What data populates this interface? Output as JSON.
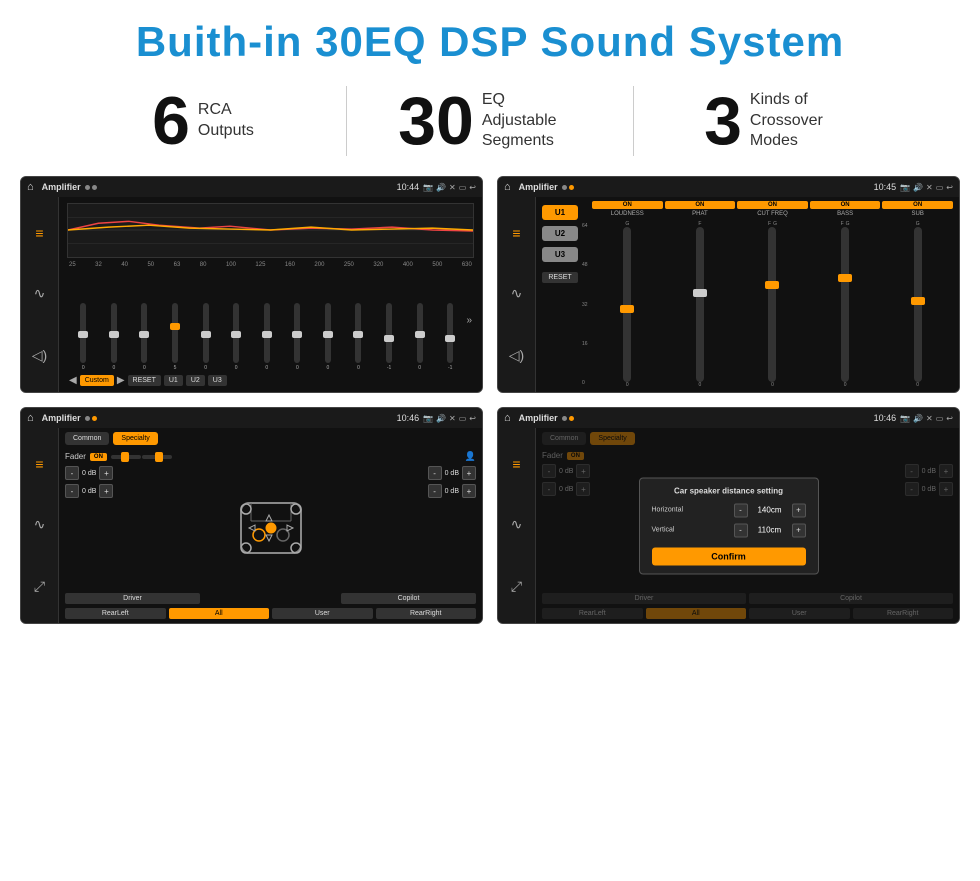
{
  "page": {
    "title": "Buith-in 30EQ DSP Sound System"
  },
  "stats": [
    {
      "number": "6",
      "label_line1": "RCA",
      "label_line2": "Outputs"
    },
    {
      "number": "30",
      "label_line1": "EQ Adjustable",
      "label_line2": "Segments"
    },
    {
      "number": "3",
      "label_line1": "Kinds of",
      "label_line2": "Crossover Modes"
    }
  ],
  "screens": [
    {
      "title": "Amplifier",
      "time": "10:44",
      "type": "eq"
    },
    {
      "title": "Amplifier",
      "time": "10:45",
      "type": "crossover"
    },
    {
      "title": "Amplifier",
      "time": "10:46",
      "type": "fader"
    },
    {
      "title": "Amplifier",
      "time": "10:46",
      "type": "distance"
    }
  ],
  "eq": {
    "freq_labels": [
      "25",
      "32",
      "40",
      "50",
      "63",
      "80",
      "100",
      "125",
      "160",
      "200",
      "250",
      "320",
      "400",
      "500",
      "630"
    ],
    "slider_values": [
      "0",
      "0",
      "0",
      "5",
      "0",
      "0",
      "0",
      "0",
      "0",
      "0",
      "-1",
      "0",
      "-1"
    ],
    "buttons": [
      "Custom",
      "RESET",
      "U1",
      "U2",
      "U3"
    ]
  },
  "crossover": {
    "u_buttons": [
      "U1",
      "U2",
      "U3"
    ],
    "channels": [
      {
        "label": "LOUDNESS",
        "on": true
      },
      {
        "label": "PHAT",
        "on": true
      },
      {
        "label": "CUT FREQ",
        "on": true
      },
      {
        "label": "BASS",
        "on": true
      },
      {
        "label": "SUB",
        "on": true
      }
    ],
    "reset_label": "RESET"
  },
  "fader": {
    "tabs": [
      "Common",
      "Specialty"
    ],
    "active_tab": "Specialty",
    "fader_label": "Fader",
    "on_badge": "ON",
    "bottom_buttons": [
      "Driver",
      "",
      "Copilot",
      "RearLeft",
      "All",
      "User",
      "RearRight"
    ]
  },
  "distance": {
    "dialog_title": "Car speaker distance setting",
    "horizontal_label": "Horizontal",
    "horizontal_value": "140cm",
    "vertical_label": "Vertical",
    "vertical_value": "110cm",
    "confirm_label": "Confirm",
    "tabs": [
      "Common",
      "Specialty"
    ],
    "on_badge": "ON",
    "bottom_buttons": [
      "Driver",
      "Copilot",
      "RearLeft",
      "All",
      "User",
      "RearRight"
    ]
  }
}
